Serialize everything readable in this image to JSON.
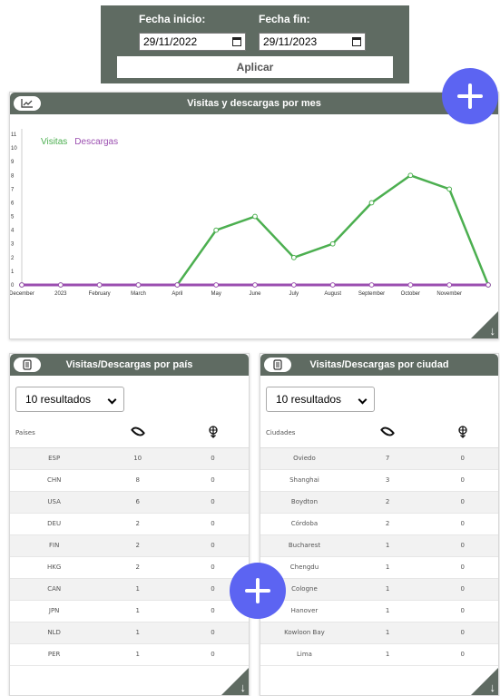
{
  "filter": {
    "start_label": "Fecha inicio:",
    "end_label": "Fecha fin:",
    "start_value": "29/11/2022",
    "end_value": "29/11/2023",
    "apply_label": "Aplicar"
  },
  "colors": {
    "header": "#5f6b62",
    "fab": "#5c64f2",
    "visitas": "#4caf50",
    "descargas": "#9b4fb0"
  },
  "chart_card": {
    "title": "Visitas y descargas por mes",
    "icon": "chart-icon",
    "download_icon": "arrow-down-icon"
  },
  "chart_data": {
    "type": "line",
    "categories": [
      "December",
      "2023",
      "February",
      "March",
      "April",
      "May",
      "June",
      "July",
      "August",
      "September",
      "October",
      "November",
      ""
    ],
    "series": [
      {
        "name": "Visitas",
        "values": [
          0,
          0,
          0,
          0,
          0,
          4,
          5,
          2,
          3,
          6,
          8,
          7,
          0
        ]
      },
      {
        "name": "Descargas",
        "values": [
          0,
          0,
          0,
          0,
          0,
          0,
          0,
          0,
          0,
          0,
          0,
          0,
          0
        ]
      }
    ],
    "ylim": [
      0,
      11
    ],
    "yticks": [
      "0",
      "1",
      "2",
      "3",
      "4",
      "5",
      "6",
      "7",
      "8",
      "9",
      "10",
      "11"
    ]
  },
  "country_card": {
    "title": "Visitas/Descargas por país",
    "select_value": "10 resultados",
    "col_label": "Países",
    "rows": [
      [
        "ESP",
        "10",
        "0"
      ],
      [
        "CHN",
        "8",
        "0"
      ],
      [
        "USA",
        "6",
        "0"
      ],
      [
        "DEU",
        "2",
        "0"
      ],
      [
        "FIN",
        "2",
        "0"
      ],
      [
        "HKG",
        "2",
        "0"
      ],
      [
        "CAN",
        "1",
        "0"
      ],
      [
        "JPN",
        "1",
        "0"
      ],
      [
        "NLD",
        "1",
        "0"
      ],
      [
        "PER",
        "1",
        "0"
      ]
    ]
  },
  "city_card": {
    "title": "Visitas/Descargas por ciudad",
    "select_value": "10 resultados",
    "col_label": "Ciudades",
    "rows": [
      [
        "Oviedo",
        "7",
        "0"
      ],
      [
        "Shanghai",
        "3",
        "0"
      ],
      [
        "Boydton",
        "2",
        "0"
      ],
      [
        "Córdoba",
        "2",
        "0"
      ],
      [
        "Bucharest",
        "1",
        "0"
      ],
      [
        "Chengdu",
        "1",
        "0"
      ],
      [
        "Cologne",
        "1",
        "0"
      ],
      [
        "Hanover",
        "1",
        "0"
      ],
      [
        "Kowloon Bay",
        "1",
        "0"
      ],
      [
        "Lima",
        "1",
        "0"
      ]
    ]
  }
}
